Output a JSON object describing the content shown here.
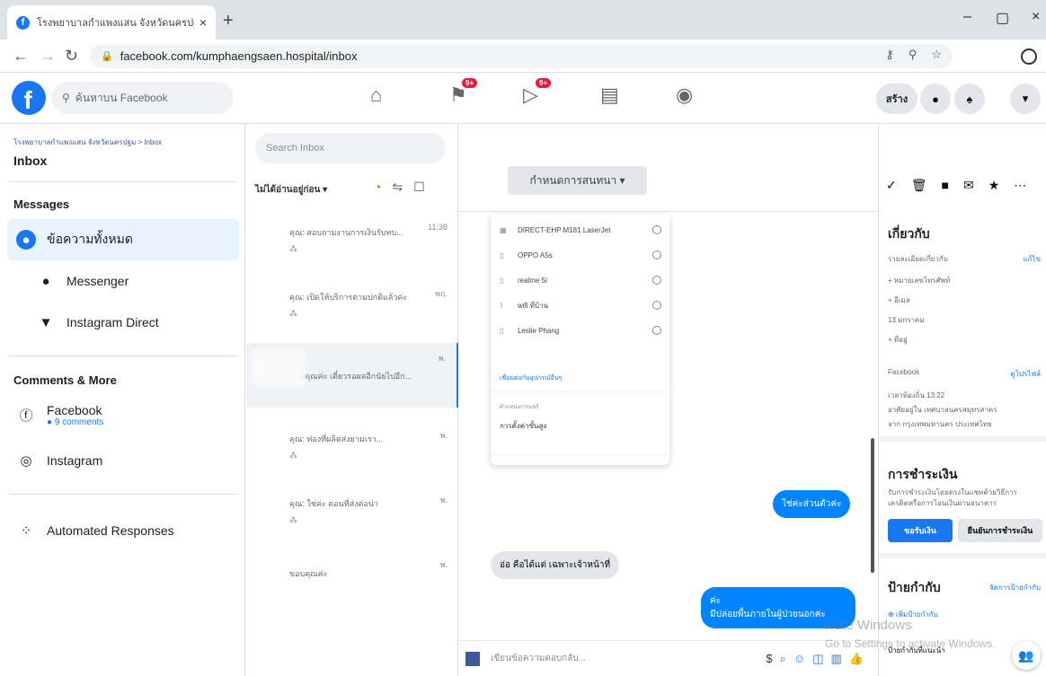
{
  "browser": {
    "tab_title": "โรงพยาบาลกำแพงแสน จังหวัดนครปฐ",
    "tab_close": "×",
    "new_tab": "+",
    "url": "facebook.com/kumphaengsaen.hospital/inbox",
    "minimize": "–",
    "maximize": "▢",
    "close": "×"
  },
  "fb": {
    "logo": "f",
    "search_placeholder": "ค้นหาบน Facebook",
    "nav_badge_1": "9+",
    "nav_badge_2": "9+",
    "create_label": "สร้าง"
  },
  "sidebar": {
    "breadcrumb": "โรงพยาบาลกำแพงแสน จังหวัดนครปฐม > Inbox",
    "title": "Inbox",
    "messages_header": "Messages",
    "items": [
      {
        "label": "ข้อความทั้งหมด"
      },
      {
        "label": "Messenger"
      },
      {
        "label": "Instagram Direct"
      }
    ],
    "comments_header": "Comments & More",
    "facebook_label": "Facebook",
    "facebook_sub": "● 9 comments",
    "instagram_label": "Instagram",
    "automated_label": "Automated Responses"
  },
  "convlist": {
    "search_placeholder": "Search Inbox",
    "filter_label": "ไม่ได้อ่านอยู่ก่อน ▾",
    "conversations": [
      {
        "time": "11:38",
        "snippet": "คุณ: สอบถามงานการเงินรับทบ...",
        "indicator": "⁂"
      },
      {
        "time": "พฤ.",
        "snippet": "คุณ: เปิดให้บริการตามปกติแล้วค่ะ",
        "indicator": "⁂"
      },
      {
        "time": "พ.",
        "snippet": "ขอบคุณค่ะ เดี๋ยวรอผลอีกนัยไปอีก...",
        "indicator": ""
      },
      {
        "time": "พ.",
        "snippet": "คุณ: ท่องที่ผลิตส่งยามเรา...",
        "indicator": "⁂"
      },
      {
        "time": "พ.",
        "snippet": "คุณ: ใช่ค่ะ ตอนที่ส่งต่อน่า",
        "indicator": "⁂"
      },
      {
        "time": "พ.",
        "snippet": "ขอบคุณค่ะ",
        "indicator": ""
      }
    ]
  },
  "chat": {
    "dropdown": "กำหนดการสนทนา ▾",
    "menu_rows": [
      {
        "label": "DIRECT-EHP M181 LaserJet"
      },
      {
        "label": "OPPO A5s"
      },
      {
        "label": "realme 5i"
      },
      {
        "label": "wifi ที่บ้าน"
      },
      {
        "label": "Leslie Phang"
      }
    ],
    "menu_link": "เชื่อมต่อกับอุปกรณ์อื่นๆ",
    "menu_label": "ตำแหน่งการแชร์",
    "menu_option": "การตั้งค่าขั้นสูง",
    "msg_out_1": "ใช่ค่ะส่วนตัวค่ะ",
    "msg_in_1": "อ่อ คือได้แต่ เฉพาะเจ้าหน้าที่",
    "msg_out_2_line1": "ค่ะ",
    "msg_out_2_line2": "มีปล่อยพื้นภายในผู้ป่วยนอกค่ะ",
    "input_placeholder": "เขียนข้อความตอบกลับ..."
  },
  "rpanel": {
    "about_header": "เกี่ยวกับ",
    "about_edit": "แก้ไข",
    "about_rows": [
      {
        "text": "รายละเอียดเกี่ยวกับ"
      },
      {
        "text": "+ หมายเลขโทรศัพท์"
      },
      {
        "text": "+ อีเมล"
      },
      {
        "text": "13 มกราคม"
      },
      {
        "text": "+ ที่อยู่"
      }
    ],
    "facebook_label": "Facebook",
    "facebook_link": "ดูโปรไฟล์",
    "fb_rows": [
      {
        "text": "เวลาท้องถิ่น 13:22"
      },
      {
        "text": "อาศัยอยู่ใน เทศบาลนครสมุทรสาคร"
      },
      {
        "text": "จาก กรุงเทพมหานคร ประเทศไทย"
      }
    ],
    "payment_header": "การชำระเงิน",
    "payment_desc_1": "รับการชำระเงินโดยตรงในแชทด้วยวิธีการ",
    "payment_desc_2": "เครดิตหรือการโอนเงินผ่านธนาคาร",
    "payment_btn_1": "ขอรับเงิน",
    "payment_btn_2": "ยืนยันการชำระเงิน",
    "labels_header": "ป้ายกำกับ",
    "labels_edit": "จัดการป้ายกำกับ",
    "labels_add": "⊕ เพิ่มป้ายกำกับ",
    "labels_suggest": "ป้ายกำกับที่แนะนำ"
  },
  "watermark": {
    "line1": "ivate Windows",
    "line2": "Go to Settings to activate Windows."
  },
  "colors": {
    "fb_blue": "#1877f2",
    "messenger_blue": "#0084ff",
    "badge_red": "#e41e3f"
  }
}
